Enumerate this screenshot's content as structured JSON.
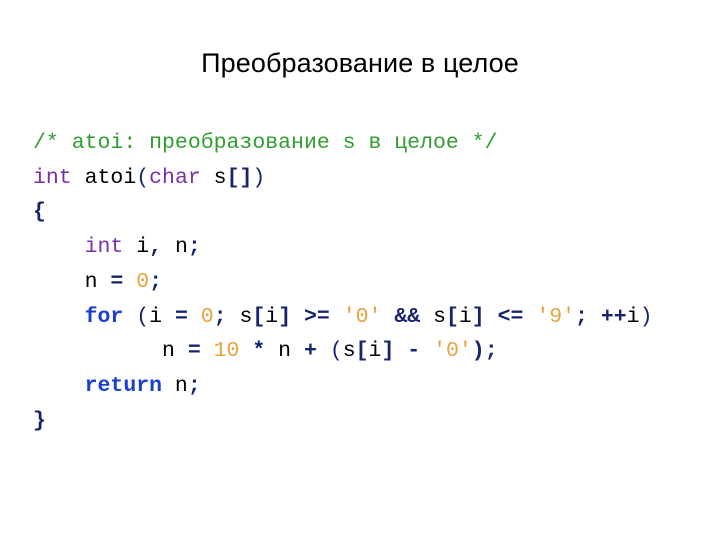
{
  "slide": {
    "title": "Преобразование в целое",
    "background_color": "#ffffff",
    "title_color": "#000000"
  },
  "colors": {
    "comment": "#2f9e2f",
    "keyword_type": "#7a2fa8",
    "keyword_control": "#1a3fd0",
    "operator": "#16246e",
    "number": "#e8a33d",
    "string": "#e8a33d",
    "plain": "#000000"
  },
  "code": {
    "language": "C",
    "lines": [
      {
        "id": "line-comment",
        "tokens": [
          {
            "t": "/* atoi: преобразование s в целое */",
            "c": "comment"
          }
        ]
      },
      {
        "id": "line-signature",
        "tokens": [
          {
            "t": "int",
            "c": "keyword"
          },
          {
            "t": " atoi",
            "c": "plain"
          },
          {
            "t": "(",
            "c": "punct"
          },
          {
            "t": "char",
            "c": "keyword"
          },
          {
            "t": " s",
            "c": "plain"
          },
          {
            "t": "[]",
            "c": "op"
          },
          {
            "t": ")",
            "c": "punct"
          }
        ]
      },
      {
        "id": "line-open-brace",
        "tokens": [
          {
            "t": "{",
            "c": "op"
          }
        ]
      },
      {
        "id": "line-decl",
        "tokens": [
          {
            "t": "    ",
            "c": "plain"
          },
          {
            "t": "int",
            "c": "keyword"
          },
          {
            "t": " i",
            "c": "plain"
          },
          {
            "t": ",",
            "c": "op"
          },
          {
            "t": " n",
            "c": "plain"
          },
          {
            "t": ";",
            "c": "op"
          }
        ]
      },
      {
        "id": "line-init-n",
        "tokens": [
          {
            "t": "    n ",
            "c": "plain"
          },
          {
            "t": "=",
            "c": "op"
          },
          {
            "t": " ",
            "c": "plain"
          },
          {
            "t": "0",
            "c": "num"
          },
          {
            "t": ";",
            "c": "op"
          }
        ]
      },
      {
        "id": "line-for",
        "tokens": [
          {
            "t": "    ",
            "c": "plain"
          },
          {
            "t": "for",
            "c": "kwbold"
          },
          {
            "t": " ",
            "c": "plain"
          },
          {
            "t": "(",
            "c": "punct"
          },
          {
            "t": "i ",
            "c": "plain"
          },
          {
            "t": "=",
            "c": "op"
          },
          {
            "t": " ",
            "c": "plain"
          },
          {
            "t": "0",
            "c": "num"
          },
          {
            "t": ";",
            "c": "op"
          },
          {
            "t": " s",
            "c": "plain"
          },
          {
            "t": "[",
            "c": "op"
          },
          {
            "t": "i",
            "c": "plain"
          },
          {
            "t": "]",
            "c": "op"
          },
          {
            "t": " ",
            "c": "plain"
          },
          {
            "t": ">=",
            "c": "op"
          },
          {
            "t": " ",
            "c": "plain"
          },
          {
            "t": "'0'",
            "c": "str"
          },
          {
            "t": " ",
            "c": "plain"
          },
          {
            "t": "&&",
            "c": "op"
          },
          {
            "t": " s",
            "c": "plain"
          },
          {
            "t": "[",
            "c": "op"
          },
          {
            "t": "i",
            "c": "plain"
          },
          {
            "t": "]",
            "c": "op"
          },
          {
            "t": " ",
            "c": "plain"
          },
          {
            "t": "<=",
            "c": "op"
          },
          {
            "t": " ",
            "c": "plain"
          },
          {
            "t": "'9'",
            "c": "str"
          },
          {
            "t": ";",
            "c": "op"
          },
          {
            "t": " ",
            "c": "plain"
          },
          {
            "t": "++",
            "c": "op"
          },
          {
            "t": "i",
            "c": "plain"
          },
          {
            "t": ")",
            "c": "punct"
          }
        ]
      },
      {
        "id": "line-accumulate",
        "tokens": [
          {
            "t": "          n ",
            "c": "plain"
          },
          {
            "t": "=",
            "c": "op"
          },
          {
            "t": " ",
            "c": "plain"
          },
          {
            "t": "10",
            "c": "num"
          },
          {
            "t": " ",
            "c": "plain"
          },
          {
            "t": "*",
            "c": "op"
          },
          {
            "t": " n ",
            "c": "plain"
          },
          {
            "t": "+",
            "c": "op"
          },
          {
            "t": " ",
            "c": "plain"
          },
          {
            "t": "(",
            "c": "punct"
          },
          {
            "t": "s",
            "c": "plain"
          },
          {
            "t": "[",
            "c": "op"
          },
          {
            "t": "i",
            "c": "plain"
          },
          {
            "t": "]",
            "c": "op"
          },
          {
            "t": " ",
            "c": "plain"
          },
          {
            "t": "-",
            "c": "op"
          },
          {
            "t": " ",
            "c": "plain"
          },
          {
            "t": "'0'",
            "c": "str"
          },
          {
            "t": ")",
            "c": "op"
          },
          {
            "t": ";",
            "c": "op"
          }
        ]
      },
      {
        "id": "line-return",
        "tokens": [
          {
            "t": "    ",
            "c": "plain"
          },
          {
            "t": "return",
            "c": "kwbold"
          },
          {
            "t": " n",
            "c": "plain"
          },
          {
            "t": ";",
            "c": "op"
          }
        ]
      },
      {
        "id": "line-close-brace",
        "tokens": [
          {
            "t": "}",
            "c": "op"
          }
        ]
      }
    ]
  }
}
